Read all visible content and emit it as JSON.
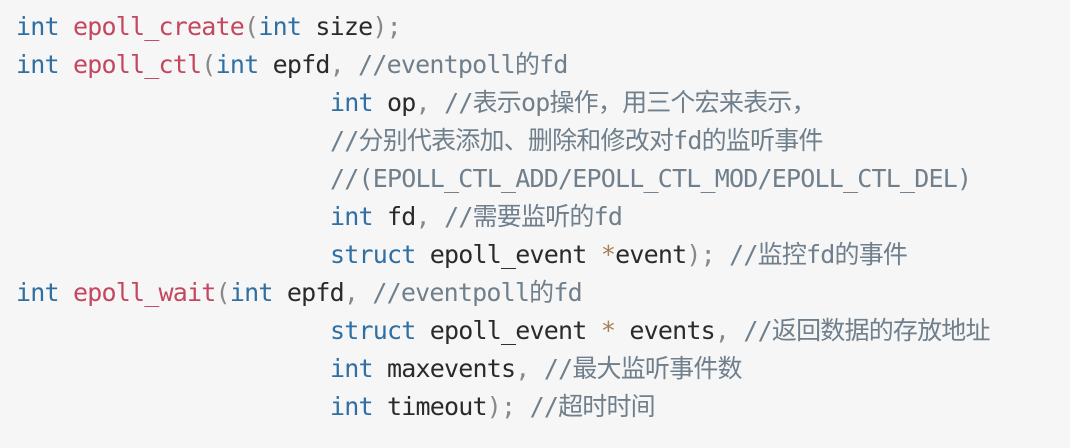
{
  "code": {
    "line1": {
      "kw_int": "int",
      "fn_name": "epoll_create",
      "paren_open": "(",
      "param_type": "int",
      "param_name": "size",
      "end": ");"
    },
    "line2": {
      "kw_int": "int",
      "fn_name": "epoll_ctl",
      "paren_open": "(",
      "param_type": "int",
      "param_name": "epfd",
      "comma": ",",
      "comment": "//eventpoll的fd"
    },
    "line3": {
      "param_type": "int",
      "param_name": "op",
      "comma": ",",
      "comment": "//表示op操作，用三个宏来表示，"
    },
    "line4": {
      "comment": "//分别代表添加、删除和修改对fd的监听事件"
    },
    "line5": {
      "comment": "//(EPOLL_CTL_ADD/EPOLL_CTL_MOD/EPOLL_CTL_DEL)"
    },
    "line6": {
      "param_type": "int",
      "param_name": "fd",
      "comma": ",",
      "comment": "//需要监听的fd"
    },
    "line7": {
      "kw_struct": "struct",
      "type_name": "epoll_event",
      "star": "*",
      "param_name": "event",
      "end": ");",
      "comment": "//监控fd的事件"
    },
    "line8": {
      "kw_int": "int",
      "fn_name": "epoll_wait",
      "paren_open": "(",
      "param_type": "int",
      "param_name": "epfd",
      "comma": ",",
      "comment": "//eventpoll的fd"
    },
    "line9": {
      "kw_struct": "struct",
      "type_name": "epoll_event",
      "star": "*",
      "param_name": "events",
      "comma": ",",
      "comment": "//返回数据的存放地址"
    },
    "line10": {
      "param_type": "int",
      "param_name": "maxevents",
      "comma": ",",
      "comment": "//最大监听事件数"
    },
    "line11": {
      "param_type": "int",
      "param_name": "timeout",
      "end": ");",
      "comment": "//超时时间"
    }
  },
  "colors": {
    "background": "#f6f6f6",
    "keyword": "#2f6fa3",
    "function": "#c44760",
    "identifier": "#2a2a2a",
    "punctuation": "#888888",
    "operator": "#a67f59",
    "comment": "#6f7f8c"
  }
}
